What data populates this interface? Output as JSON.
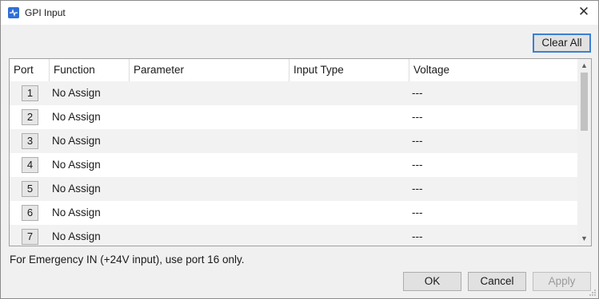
{
  "window": {
    "title": "GPI Input",
    "close_glyph": "✕"
  },
  "toolbar": {
    "clear_all_label": "Clear All"
  },
  "table": {
    "columns": [
      "Port",
      "Function",
      "Parameter",
      "Input Type",
      "Voltage"
    ],
    "rows": [
      {
        "port": "1",
        "function": "No Assign",
        "parameter": "",
        "input_type": "",
        "voltage": "---"
      },
      {
        "port": "2",
        "function": "No Assign",
        "parameter": "",
        "input_type": "",
        "voltage": "---"
      },
      {
        "port": "3",
        "function": "No Assign",
        "parameter": "",
        "input_type": "",
        "voltage": "---"
      },
      {
        "port": "4",
        "function": "No Assign",
        "parameter": "",
        "input_type": "",
        "voltage": "---"
      },
      {
        "port": "5",
        "function": "No Assign",
        "parameter": "",
        "input_type": "",
        "voltage": "---"
      },
      {
        "port": "6",
        "function": "No Assign",
        "parameter": "",
        "input_type": "",
        "voltage": "---"
      },
      {
        "port": "7",
        "function": "No Assign",
        "parameter": "",
        "input_type": "",
        "voltage": "---"
      }
    ]
  },
  "scrollbar": {
    "up_glyph": "▲",
    "down_glyph": "▼"
  },
  "note": "For Emergency IN (+24V input), use port 16 only.",
  "footer": {
    "ok_label": "OK",
    "cancel_label": "Cancel",
    "apply_label": "Apply"
  },
  "colors": {
    "accent": "#3c7fd1",
    "app_icon": "#2f6fd6"
  },
  "icons": {
    "app": "app-icon",
    "close": "close-icon",
    "scroll_up": "scroll-up-arrow-icon",
    "scroll_down": "scroll-down-arrow-icon",
    "resize_grip": "resize-grip-icon"
  }
}
